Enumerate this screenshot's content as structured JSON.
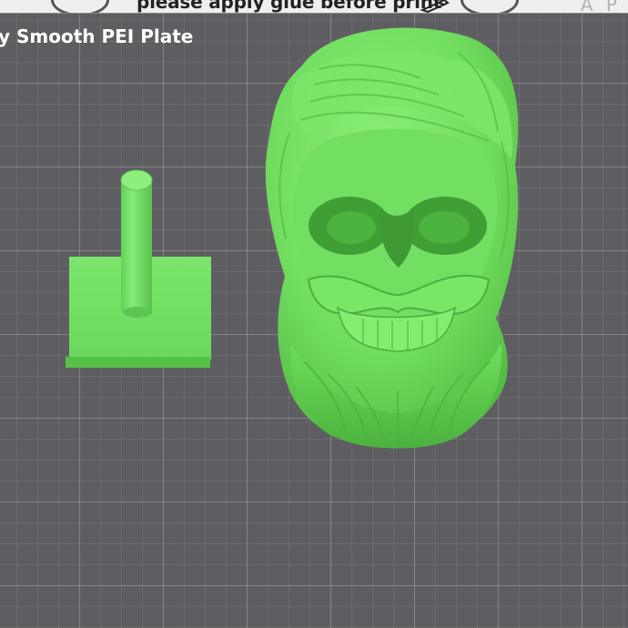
{
  "banner": {
    "notice": "please apply glue before print",
    "brand_mark": "A P"
  },
  "plate": {
    "label": "y Smooth PEI Plate"
  },
  "objects": [
    {
      "name": "support-tower-model",
      "kind": "calibration tower"
    },
    {
      "name": "bearded-skull-model",
      "kind": "bearded skull sculpture"
    }
  ],
  "colors": {
    "bed": "#5e5e62",
    "grid_major": "rgba(255,255,255,0.16)",
    "grid_minor": "rgba(255,255,255,0.08)",
    "model": "#72e062",
    "model_shadow": "#4fb842",
    "banner_bg": "#efefef"
  },
  "icons": {
    "pencil": "pencil-icon"
  }
}
